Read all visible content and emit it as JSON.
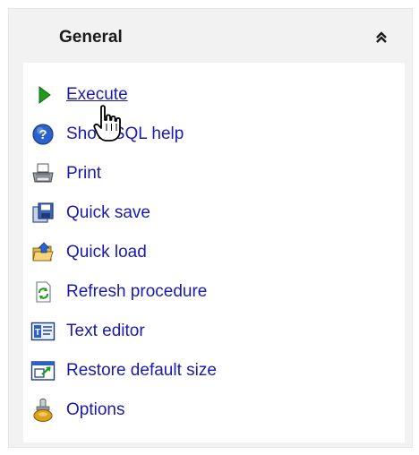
{
  "panel": {
    "title": "General",
    "items": [
      {
        "label": "Execute",
        "icon": "play-icon"
      },
      {
        "label": "Show SQL help",
        "icon": "help-icon"
      },
      {
        "label": "Print",
        "icon": "printer-icon"
      },
      {
        "label": "Quick save",
        "icon": "save-icon"
      },
      {
        "label": "Quick load",
        "icon": "load-icon"
      },
      {
        "label": "Refresh procedure",
        "icon": "refresh-icon"
      },
      {
        "label": "Text editor",
        "icon": "text-editor-icon"
      },
      {
        "label": "Restore default size",
        "icon": "restore-size-icon"
      },
      {
        "label": "Options",
        "icon": "options-icon"
      }
    ]
  },
  "colors": {
    "link": "#1a1ab0",
    "header_bg": "#f2f2f2",
    "body_bg": "#ffffff"
  }
}
